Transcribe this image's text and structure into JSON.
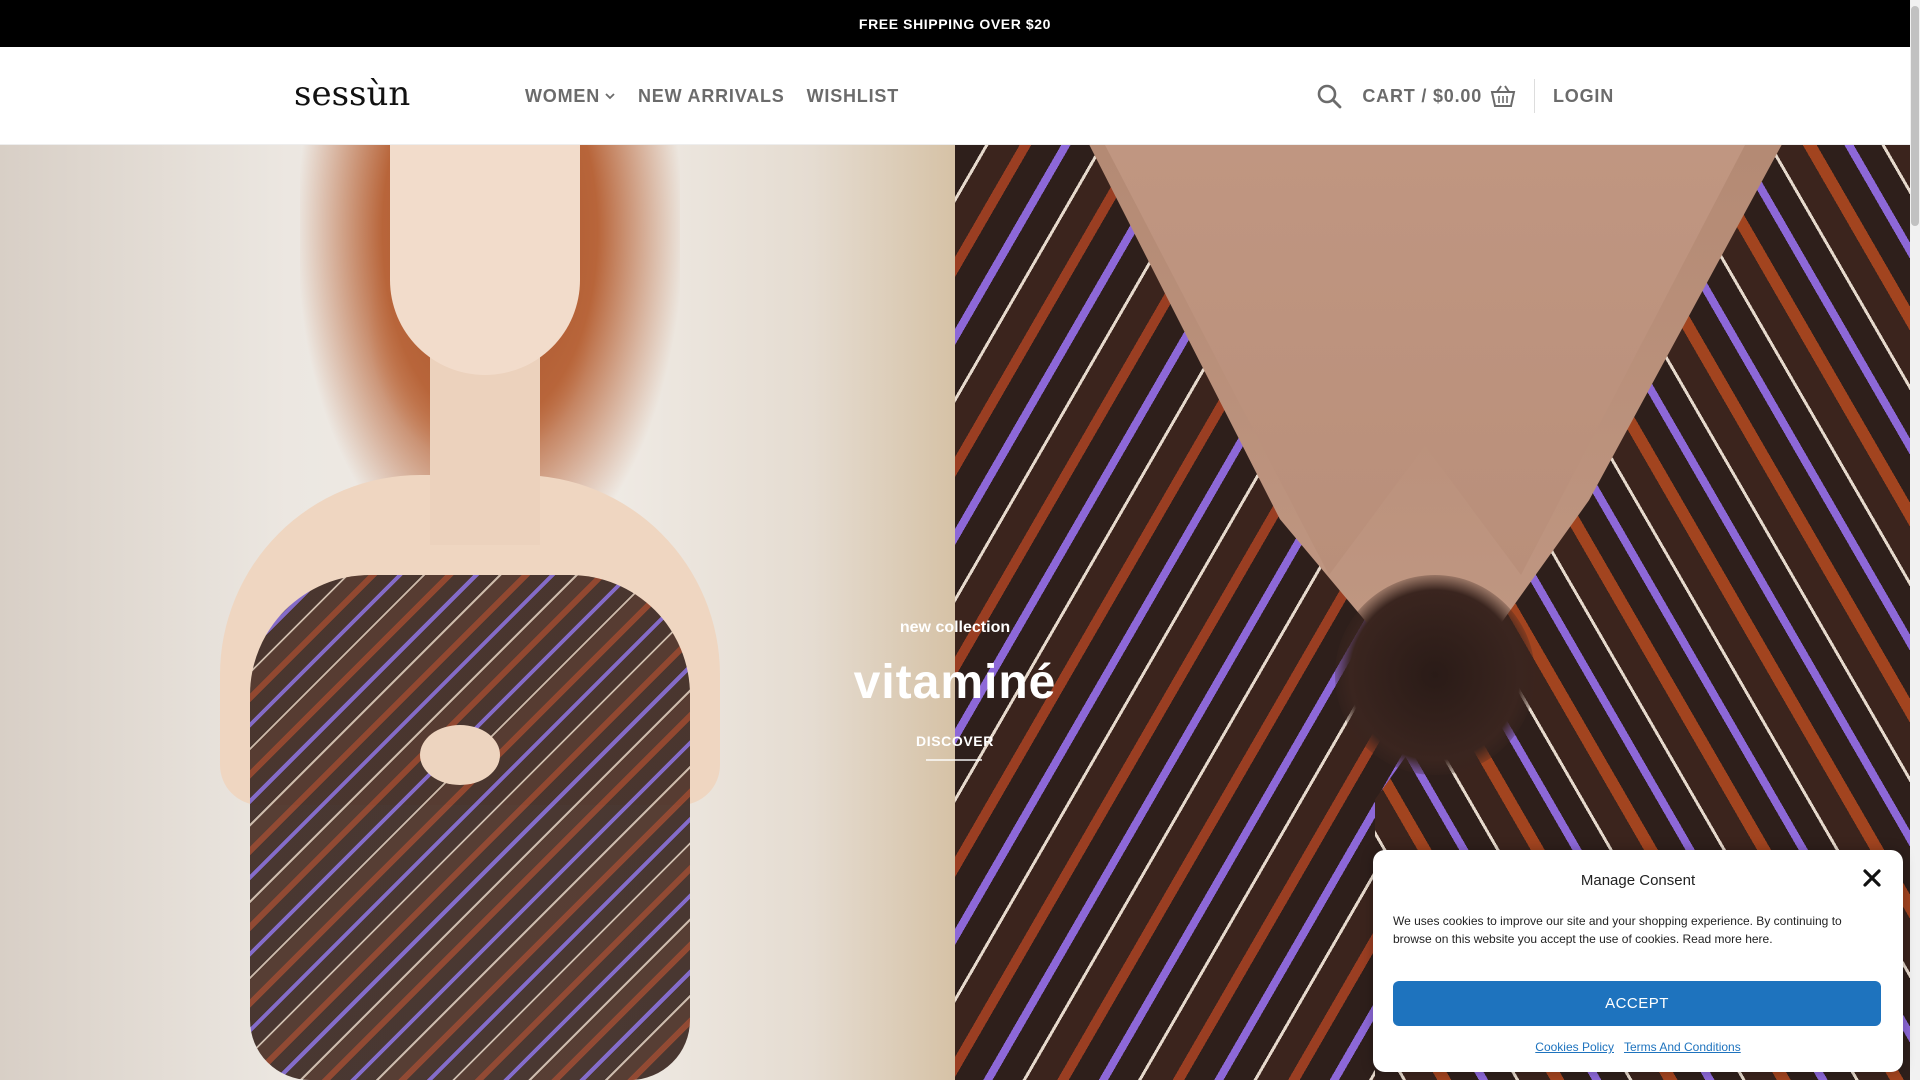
{
  "announcement": {
    "text": "FREE SHIPPING OVER $20"
  },
  "header": {
    "logo_text": "sessùn",
    "nav": [
      {
        "label": "WOMEN",
        "has_dropdown": true
      },
      {
        "label": "NEW ARRIVALS"
      },
      {
        "label": "WISHLIST"
      }
    ],
    "cart_label": "CART / $0.00",
    "login_label": "LOGIN",
    "icons": {
      "search": "search-icon",
      "cart": "basket-icon",
      "dropdown": "chevron-down-icon"
    }
  },
  "hero": {
    "kicker": "new collection",
    "headline": "vitaminé",
    "cta": "DISCOVER"
  },
  "consent": {
    "title": "Manage Consent",
    "body": "We uses cookies to improve our site and your shopping experience. By continuing to browse on this website you accept the use of cookies. Read more here.",
    "accept_label": "ACCEPT",
    "links": [
      "Cookies Policy",
      "Terms And Conditions"
    ],
    "close_icon": "close-icon"
  },
  "colors": {
    "topbar_bg": "#000000",
    "nav_text": "#6b6b6b",
    "accept_button": "#1e73be",
    "link": "#1e73be"
  }
}
